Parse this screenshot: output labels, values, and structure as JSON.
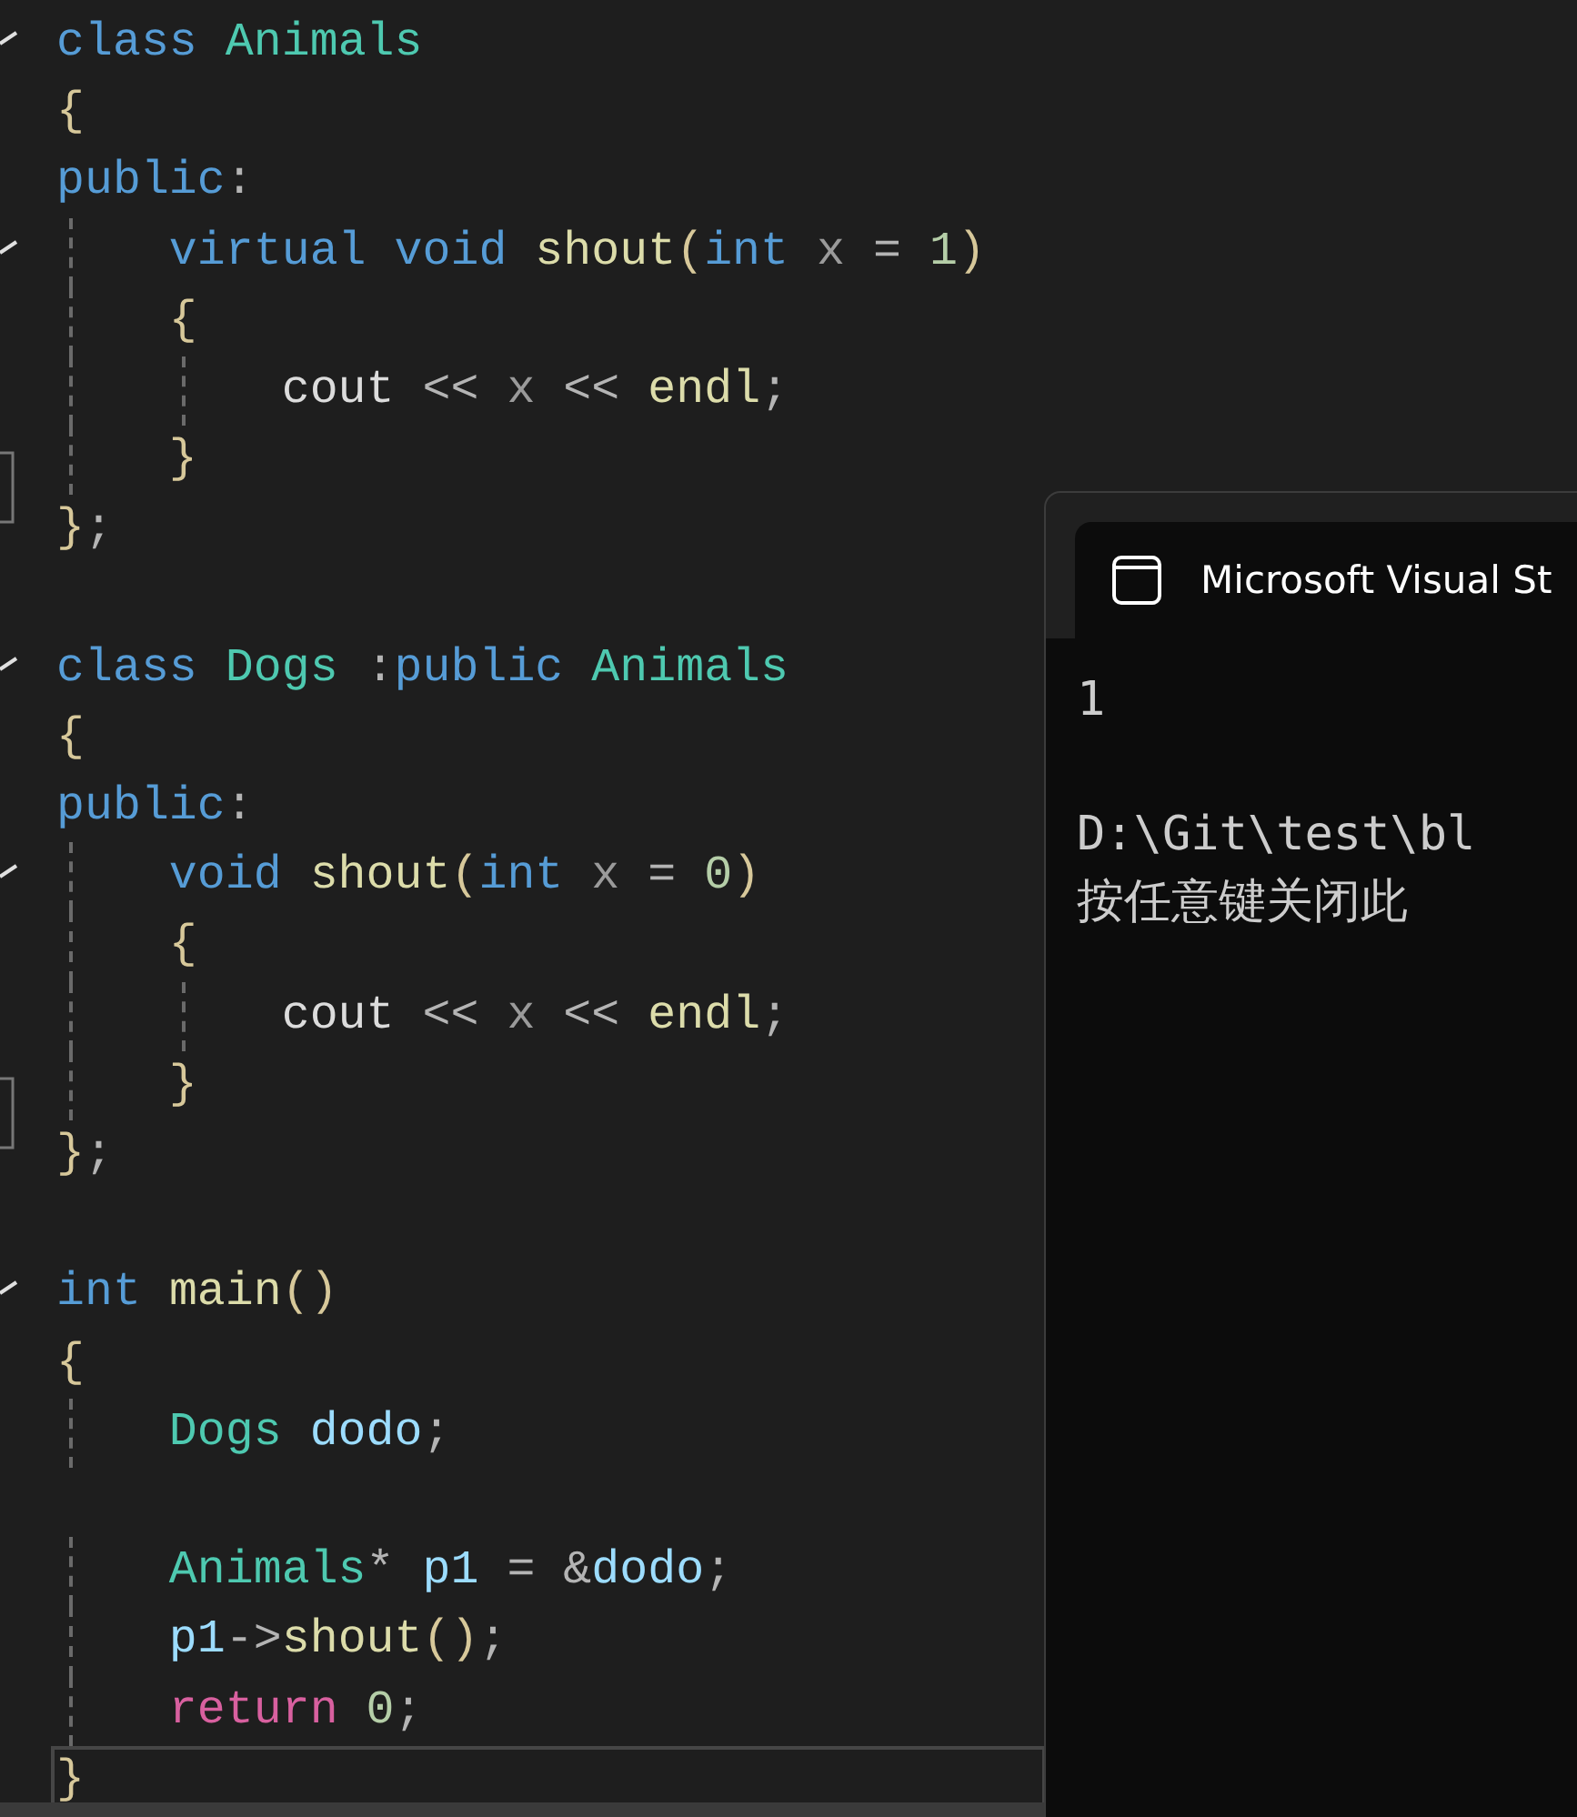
{
  "editor": {
    "blocks": [
      {
        "lines": [
          {
            "fold_start": true,
            "fold_end": false,
            "current": false,
            "tokens": [
              {
                "kind": "keyword",
                "text": "class "
              },
              {
                "kind": "type",
                "text": "Animals"
              }
            ]
          },
          {
            "fold_start": false,
            "fold_end": false,
            "current": false,
            "tokens": [
              {
                "kind": "brace",
                "text": "{"
              }
            ]
          },
          {
            "fold_start": false,
            "fold_end": false,
            "current": false,
            "tokens": [
              {
                "kind": "keyword",
                "text": "public"
              },
              {
                "kind": "punct",
                "text": ":"
              }
            ]
          },
          {
            "fold_start": true,
            "fold_end": false,
            "current": false,
            "tokens": [
              {
                "kind": "keyword",
                "text": "    virtual void "
              },
              {
                "kind": "function",
                "text": "shout"
              },
              {
                "kind": "brace",
                "text": "("
              },
              {
                "kind": "keyword",
                "text": "int "
              },
              {
                "kind": "param",
                "text": "x "
              },
              {
                "kind": "punct",
                "text": "= "
              },
              {
                "kind": "number",
                "text": "1"
              },
              {
                "kind": "brace",
                "text": ")"
              }
            ]
          },
          {
            "fold_start": false,
            "fold_end": false,
            "current": false,
            "tokens": [
              {
                "kind": "brace",
                "text": "    {"
              }
            ]
          },
          {
            "fold_start": false,
            "fold_end": false,
            "current": false,
            "tokens": [
              {
                "kind": "plain",
                "text": "        cout "
              },
              {
                "kind": "punct",
                "text": "<< "
              },
              {
                "kind": "param",
                "text": "x "
              },
              {
                "kind": "punct",
                "text": "<< "
              },
              {
                "kind": "function",
                "text": "endl"
              },
              {
                "kind": "punct",
                "text": ";"
              }
            ]
          },
          {
            "fold_start": false,
            "fold_end": false,
            "current": false,
            "tokens": [
              {
                "kind": "brace",
                "text": "    }"
              }
            ]
          },
          {
            "fold_start": false,
            "fold_end": true,
            "current": false,
            "tokens": [
              {
                "kind": "brace",
                "text": "}"
              },
              {
                "kind": "punct",
                "text": ";"
              }
            ]
          }
        ]
      },
      {
        "lines": [
          {
            "fold_start": true,
            "fold_end": false,
            "current": false,
            "tokens": [
              {
                "kind": "keyword",
                "text": "class "
              },
              {
                "kind": "type",
                "text": "Dogs "
              },
              {
                "kind": "punct",
                "text": ":"
              },
              {
                "kind": "keyword",
                "text": "public "
              },
              {
                "kind": "type",
                "text": "Animals"
              }
            ]
          },
          {
            "fold_start": false,
            "fold_end": false,
            "current": false,
            "tokens": [
              {
                "kind": "brace",
                "text": "{"
              }
            ]
          },
          {
            "fold_start": false,
            "fold_end": false,
            "current": false,
            "tokens": [
              {
                "kind": "keyword",
                "text": "public"
              },
              {
                "kind": "punct",
                "text": ":"
              }
            ]
          },
          {
            "fold_start": true,
            "fold_end": false,
            "current": false,
            "tokens": [
              {
                "kind": "keyword",
                "text": "    void "
              },
              {
                "kind": "function",
                "text": "shout"
              },
              {
                "kind": "brace",
                "text": "("
              },
              {
                "kind": "keyword",
                "text": "int "
              },
              {
                "kind": "param",
                "text": "x "
              },
              {
                "kind": "punct",
                "text": "= "
              },
              {
                "kind": "number",
                "text": "0"
              },
              {
                "kind": "brace",
                "text": ")"
              }
            ]
          },
          {
            "fold_start": false,
            "fold_end": false,
            "current": false,
            "tokens": [
              {
                "kind": "brace",
                "text": "    {"
              }
            ]
          },
          {
            "fold_start": false,
            "fold_end": false,
            "current": false,
            "tokens": [
              {
                "kind": "plain",
                "text": "        cout "
              },
              {
                "kind": "punct",
                "text": "<< "
              },
              {
                "kind": "param",
                "text": "x "
              },
              {
                "kind": "punct",
                "text": "<< "
              },
              {
                "kind": "function",
                "text": "endl"
              },
              {
                "kind": "punct",
                "text": ";"
              }
            ]
          },
          {
            "fold_start": false,
            "fold_end": false,
            "current": false,
            "tokens": [
              {
                "kind": "brace",
                "text": "    }"
              }
            ]
          },
          {
            "fold_start": false,
            "fold_end": true,
            "current": false,
            "tokens": [
              {
                "kind": "brace",
                "text": "}"
              },
              {
                "kind": "punct",
                "text": ";"
              }
            ]
          }
        ]
      },
      {
        "lines": [
          {
            "fold_start": true,
            "fold_end": false,
            "current": false,
            "tokens": [
              {
                "kind": "keyword",
                "text": "int "
              },
              {
                "kind": "function",
                "text": "main"
              },
              {
                "kind": "brace",
                "text": "()"
              }
            ]
          },
          {
            "fold_start": false,
            "fold_end": false,
            "current": false,
            "tokens": [
              {
                "kind": "brace",
                "text": "{"
              }
            ]
          },
          {
            "fold_start": false,
            "fold_end": false,
            "current": false,
            "tokens": [
              {
                "kind": "type",
                "text": "    Dogs "
              },
              {
                "kind": "variable",
                "text": "dodo"
              },
              {
                "kind": "punct",
                "text": ";"
              }
            ]
          }
        ]
      },
      {
        "lines": [
          {
            "fold_start": false,
            "fold_end": false,
            "current": false,
            "tokens": [
              {
                "kind": "type",
                "text": "    Animals"
              },
              {
                "kind": "punct",
                "text": "* "
              },
              {
                "kind": "variable",
                "text": "p1 "
              },
              {
                "kind": "punct",
                "text": "= &"
              },
              {
                "kind": "variable",
                "text": "dodo"
              },
              {
                "kind": "punct",
                "text": ";"
              }
            ]
          },
          {
            "fold_start": false,
            "fold_end": false,
            "current": false,
            "tokens": [
              {
                "kind": "variable",
                "text": "    p1"
              },
              {
                "kind": "punct",
                "text": "->"
              },
              {
                "kind": "function",
                "text": "shout"
              },
              {
                "kind": "brace",
                "text": "()"
              },
              {
                "kind": "punct",
                "text": ";"
              }
            ]
          },
          {
            "fold_start": false,
            "fold_end": false,
            "current": false,
            "tokens": [
              {
                "kind": "control",
                "text": "    return "
              },
              {
                "kind": "number",
                "text": "0"
              },
              {
                "kind": "punct",
                "text": ";"
              }
            ]
          },
          {
            "fold_start": false,
            "fold_end": false,
            "current": true,
            "tokens": [
              {
                "kind": "brace",
                "text": "}"
              }
            ]
          }
        ]
      }
    ]
  },
  "console": {
    "title": "Microsoft Visual St",
    "output": "1",
    "messages": [
      "D:\\Git\\test\\bl",
      "按任意键关闭此"
    ]
  }
}
